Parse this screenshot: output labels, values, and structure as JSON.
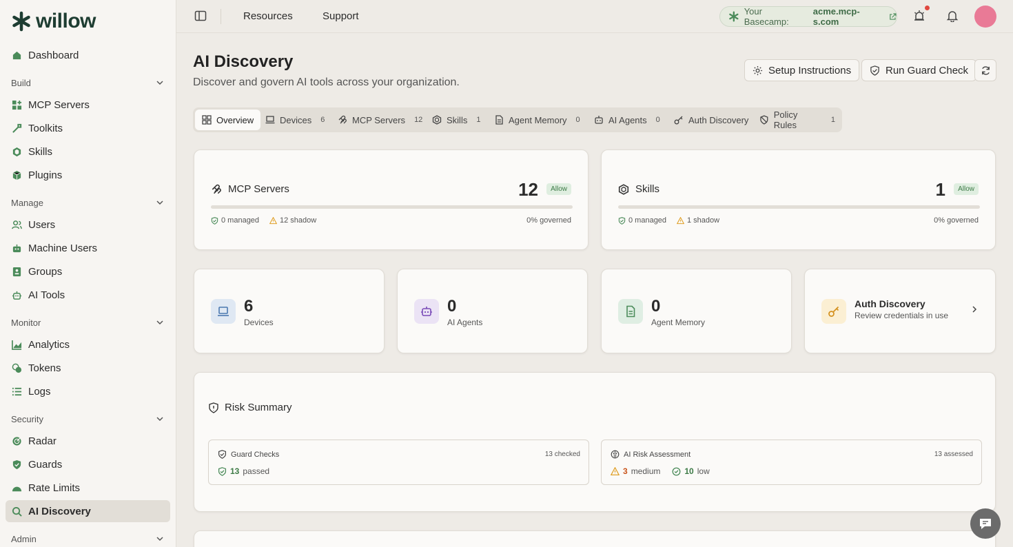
{
  "brand": {
    "name": "willow"
  },
  "sidebar": {
    "dashboard": "Dashboard",
    "sections": {
      "build": "Build",
      "manage": "Manage",
      "monitor": "Monitor",
      "security": "Security",
      "admin": "Admin"
    },
    "items": {
      "mcp_servers": "MCP Servers",
      "toolkits": "Toolkits",
      "skills": "Skills",
      "plugins": "Plugins",
      "users": "Users",
      "machine_users": "Machine Users",
      "groups": "Groups",
      "ai_tools": "AI Tools",
      "analytics": "Analytics",
      "tokens": "Tokens",
      "logs": "Logs",
      "radar": "Radar",
      "guards": "Guards",
      "rate_limits": "Rate Limits",
      "ai_discovery": "AI Discovery"
    }
  },
  "topbar": {
    "resources": "Resources",
    "support": "Support",
    "basecamp_label": "Your Basecamp:",
    "basecamp_url": "acme.mcp-s.com"
  },
  "page": {
    "title": "AI Discovery",
    "subtitle": "Discover and govern AI tools across your organization.",
    "setup_btn": "Setup Instructions",
    "guard_btn": "Run Guard Check"
  },
  "tabs": [
    {
      "label": "Overview",
      "count": ""
    },
    {
      "label": "Devices",
      "count": "6"
    },
    {
      "label": "MCP Servers",
      "count": "12"
    },
    {
      "label": "Skills",
      "count": "1"
    },
    {
      "label": "Agent Memory",
      "count": "0"
    },
    {
      "label": "AI Agents",
      "count": "0"
    },
    {
      "label": "Auth Discovery",
      "count": ""
    },
    {
      "label": "Policy Rules",
      "count": "1"
    }
  ],
  "mcp_card": {
    "title": "MCP Servers",
    "count": "12",
    "badge": "Allow",
    "managed": "0 managed",
    "shadow": "12 shadow",
    "governed": "0% governed",
    "governed_fraction": 0
  },
  "skills_card": {
    "title": "Skills",
    "count": "1",
    "badge": "Allow",
    "managed": "0 managed",
    "shadow": "1 shadow",
    "governed": "0% governed",
    "governed_fraction": 0
  },
  "stats": {
    "devices": {
      "value": "6",
      "label": "Devices"
    },
    "agents": {
      "value": "0",
      "label": "AI Agents"
    },
    "memory": {
      "value": "0",
      "label": "Agent Memory"
    },
    "auth": {
      "title": "Auth Discovery",
      "subtitle": "Review credentials in use"
    }
  },
  "risk": {
    "title": "Risk Summary",
    "guard": {
      "title": "Guard Checks",
      "checked": "13 checked",
      "passed_num": "13",
      "passed_label": "passed"
    },
    "assessment": {
      "title": "AI Risk Assessment",
      "assessed": "13 assessed",
      "medium_num": "3",
      "medium_label": "medium",
      "low_num": "10",
      "low_label": "low"
    }
  },
  "colors": {
    "brand": "#1e3d32",
    "accent_green": "#4b8b5a",
    "warning": "#e0a12a",
    "avatar": "#e97a96"
  }
}
